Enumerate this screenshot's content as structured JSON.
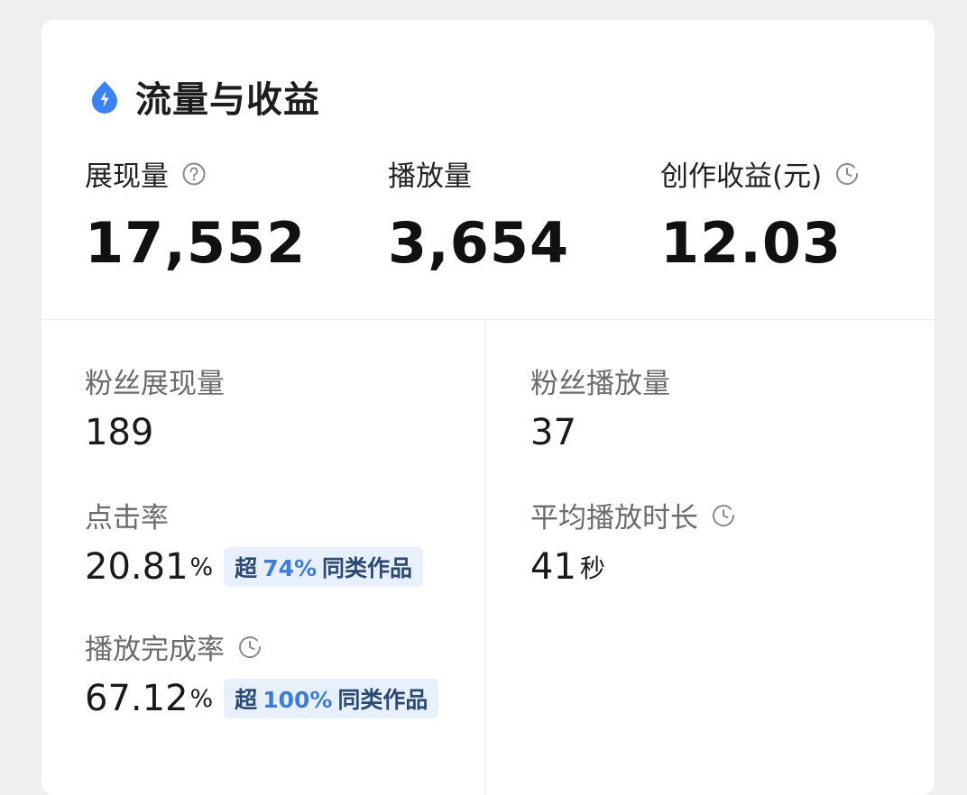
{
  "header": {
    "title": "流量与收益",
    "icon": "lightning-drop-icon",
    "icon_color": "#3b82f6"
  },
  "top_metrics": [
    {
      "label": "展现量",
      "value": "17,552",
      "icon": "question-circle-icon"
    },
    {
      "label": "播放量",
      "value": "3,654"
    },
    {
      "label": "创作收益(元)",
      "value": "12.03",
      "icon": "clock-icon"
    }
  ],
  "sub_metrics": {
    "fan_impressions": {
      "label": "粉丝展现量",
      "value": "189"
    },
    "fan_plays": {
      "label": "粉丝播放量",
      "value": "37"
    },
    "ctr": {
      "label": "点击率",
      "value": "20.81",
      "unit": "%",
      "badge": {
        "prefix": "超",
        "percent": "74%",
        "suffix": "同类作品"
      }
    },
    "avg_duration": {
      "label": "平均播放时长",
      "value": "41",
      "unit": "秒",
      "icon": "clock-icon"
    },
    "completion": {
      "label": "播放完成率",
      "value": "67.12",
      "unit": "%",
      "icon": "clock-icon",
      "badge": {
        "prefix": "超",
        "percent": "100%",
        "suffix": "同类作品"
      }
    }
  },
  "colors": {
    "background": "#efefef",
    "card": "#ffffff",
    "badge_bg": "#e7f0fb",
    "badge_accent": "#3d7dd8"
  }
}
